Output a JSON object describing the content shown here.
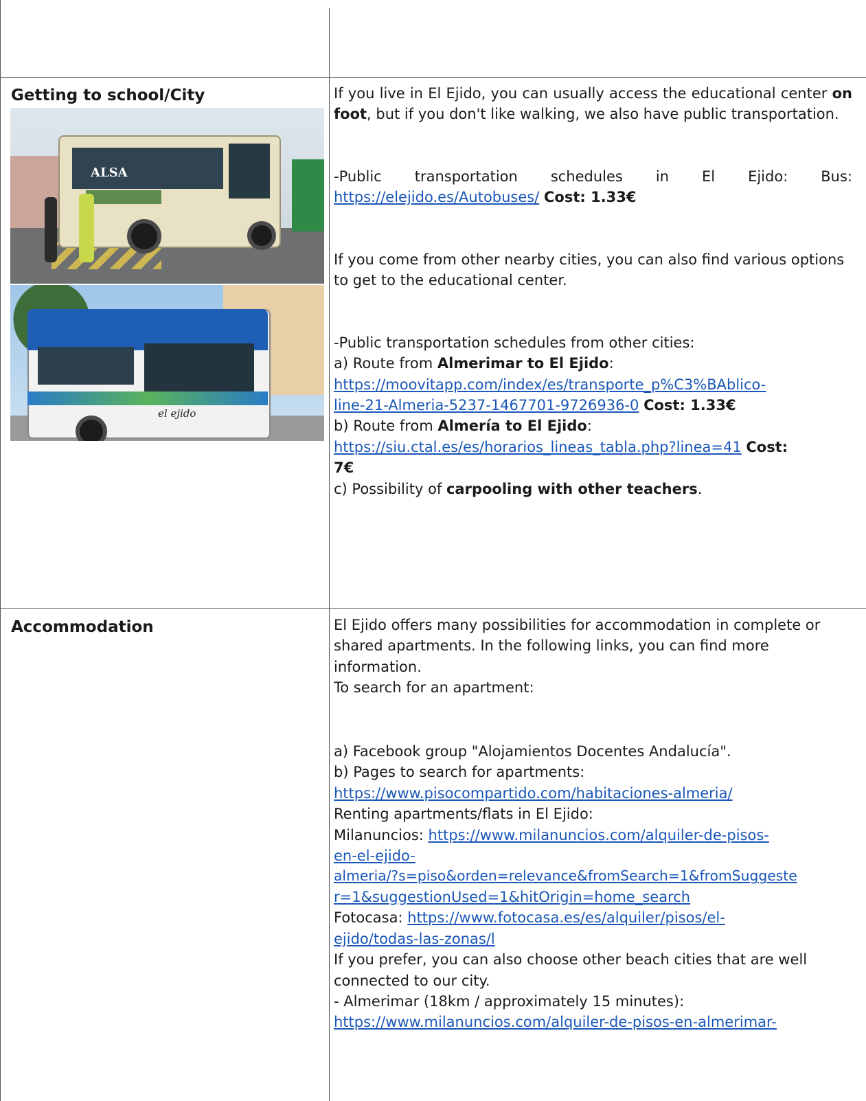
{
  "rows": [
    {
      "label": "Getting to school/City",
      "images": [
        {
          "icon": "alsa-bus-photo",
          "brand_text": "ALSA"
        },
        {
          "icon": "el-ejido-city-bus-photo",
          "brand_text": "el ejido"
        }
      ],
      "p1_pre": "If you live in El Ejido, you can usually access the educational center",
      "p1_bold": "on foot",
      "p1_post": ", but if you don't like walking, we also have public transportation.",
      "p2_pre": "-Public transportation schedules in El Ejido: Bus:",
      "p2_link": "https://elejido.es/Autobuses/",
      "p2_cost": "Cost: 1.33€",
      "p3": "If you come from other nearby cities, you can also find various options to get to the educational center.",
      "p4": "-Public transportation schedules from other cities:",
      "route_a_pre": "a) Route from ",
      "route_a_bold": "Almerimar to El Ejido",
      "route_a_post": ":",
      "route_a_link_1": "https://moovitapp.com/index/es/transporte_p%C3%BAblico-",
      "route_a_link_2": "line-21-Almeria-5237-1467701-9726936-0",
      "route_a_cost": "Cost: 1.33€",
      "route_b_pre": "b) Route from ",
      "route_b_bold": "Almería to El Ejido",
      "route_b_post": ":",
      "route_b_link": "https://siu.ctal.es/es/horarios_lineas_tabla.php?linea=41",
      "route_b_cost_1": "Cost:",
      "route_b_cost_2": "7€",
      "route_c_pre": "c) Possibility of ",
      "route_c_bold": "carpooling with other teachers",
      "route_c_post": "."
    },
    {
      "label": "Accommodation",
      "p1": "El Ejido offers many possibilities for accommodation in complete or shared apartments. In the following links, you can find more information.",
      "p2": "To search for an apartment:",
      "a": "a) Facebook group \"Alojamientos Docentes Andalucía\".",
      "b": "b) Pages to search for apartments:",
      "b_link": "https://www.pisocompartido.com/habitaciones-almeria/",
      "renting": "Renting apartments/flats in El Ejido:",
      "milanuncios_label": "Milanuncios: ",
      "milanuncios_link_1": "https://www.milanuncios.com/alquiler-de-pisos-",
      "milanuncios_link_2": "en-el-ejido-",
      "milanuncios_link_3": "almeria/?s=piso&orden=relevance&fromSearch=1&fromSuggeste",
      "milanuncios_link_4": "r=1&suggestionUsed=1&hitOrigin=home_search",
      "fotocasa_label": "Fotocasa: ",
      "fotocasa_link_1": "https://www.fotocasa.es/es/alquiler/pisos/el-",
      "fotocasa_link_2": "ejido/todas-las-zonas/l",
      "beach": "If you prefer, you can also choose other beach cities that are well connected to our city.",
      "almerimar": "- Almerimar (18km / approximately 15 minutes):",
      "almerimar_link": "https://www.milanuncios.com/alquiler-de-pisos-en-almerimar-"
    }
  ]
}
